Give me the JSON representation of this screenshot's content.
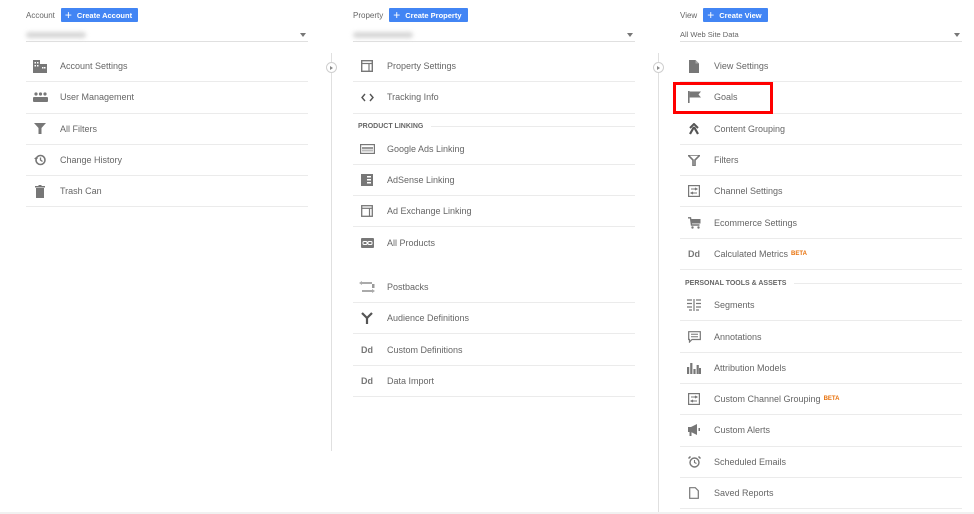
{
  "account": {
    "label": "Account",
    "create_button": "Create Account",
    "selected_value": "",
    "items": [
      {
        "label": "Account Settings",
        "icon": "building-icon"
      },
      {
        "label": "User Management",
        "icon": "people-icon"
      },
      {
        "label": "All Filters",
        "icon": "filter-icon"
      },
      {
        "label": "Change History",
        "icon": "history-icon"
      },
      {
        "label": "Trash Can",
        "icon": "trash-icon"
      }
    ]
  },
  "property": {
    "label": "Property",
    "create_button": "Create Property",
    "selected_value": "",
    "items": [
      {
        "label": "Property Settings",
        "icon": "window-icon"
      },
      {
        "label": "Tracking Info",
        "icon": "code-icon"
      }
    ],
    "product_linking_title": "PRODUCT LINKING",
    "product_linking": [
      {
        "label": "Google Ads Linking",
        "icon": "ads-icon"
      },
      {
        "label": "AdSense Linking",
        "icon": "adsense-icon"
      },
      {
        "label": "Ad Exchange Linking",
        "icon": "ad-exchange-icon"
      },
      {
        "label": "All Products",
        "icon": "link-icon"
      }
    ],
    "more_items": [
      {
        "label": "Postbacks",
        "icon": "postbacks-icon"
      },
      {
        "label": "Audience Definitions",
        "icon": "audience-icon"
      },
      {
        "label": "Custom Definitions",
        "icon": "dd-icon",
        "glyph": "Dd"
      },
      {
        "label": "Data Import",
        "icon": "dd-icon",
        "glyph": "Dd"
      }
    ]
  },
  "view": {
    "label": "View",
    "create_button": "Create View",
    "selected_value": "All Web Site Data",
    "items": [
      {
        "label": "View Settings",
        "icon": "document-icon"
      },
      {
        "label": "Goals",
        "icon": "flag-icon",
        "highlighted": true
      },
      {
        "label": "Content Grouping",
        "icon": "content-grouping-icon"
      },
      {
        "label": "Filters",
        "icon": "filter-icon"
      },
      {
        "label": "Channel Settings",
        "icon": "channel-icon"
      },
      {
        "label": "Ecommerce Settings",
        "icon": "cart-icon"
      },
      {
        "label": "Calculated Metrics",
        "icon": "dd-icon",
        "glyph": "Dd",
        "badge": "BETA"
      }
    ],
    "personal_title": "PERSONAL TOOLS & ASSETS",
    "personal_items": [
      {
        "label": "Segments",
        "icon": "segments-icon"
      },
      {
        "label": "Annotations",
        "icon": "annotation-icon"
      },
      {
        "label": "Attribution Models",
        "icon": "bar-chart-icon"
      },
      {
        "label": "Custom Channel Grouping",
        "icon": "channel-icon",
        "badge": "BETA"
      },
      {
        "label": "Custom Alerts",
        "icon": "megaphone-icon"
      },
      {
        "label": "Scheduled Emails",
        "icon": "alarm-icon"
      },
      {
        "label": "Saved Reports",
        "icon": "file-icon"
      }
    ]
  },
  "colors": {
    "accent": "#4285f4",
    "highlight": "#ff0000",
    "beta": "#e8710a"
  }
}
